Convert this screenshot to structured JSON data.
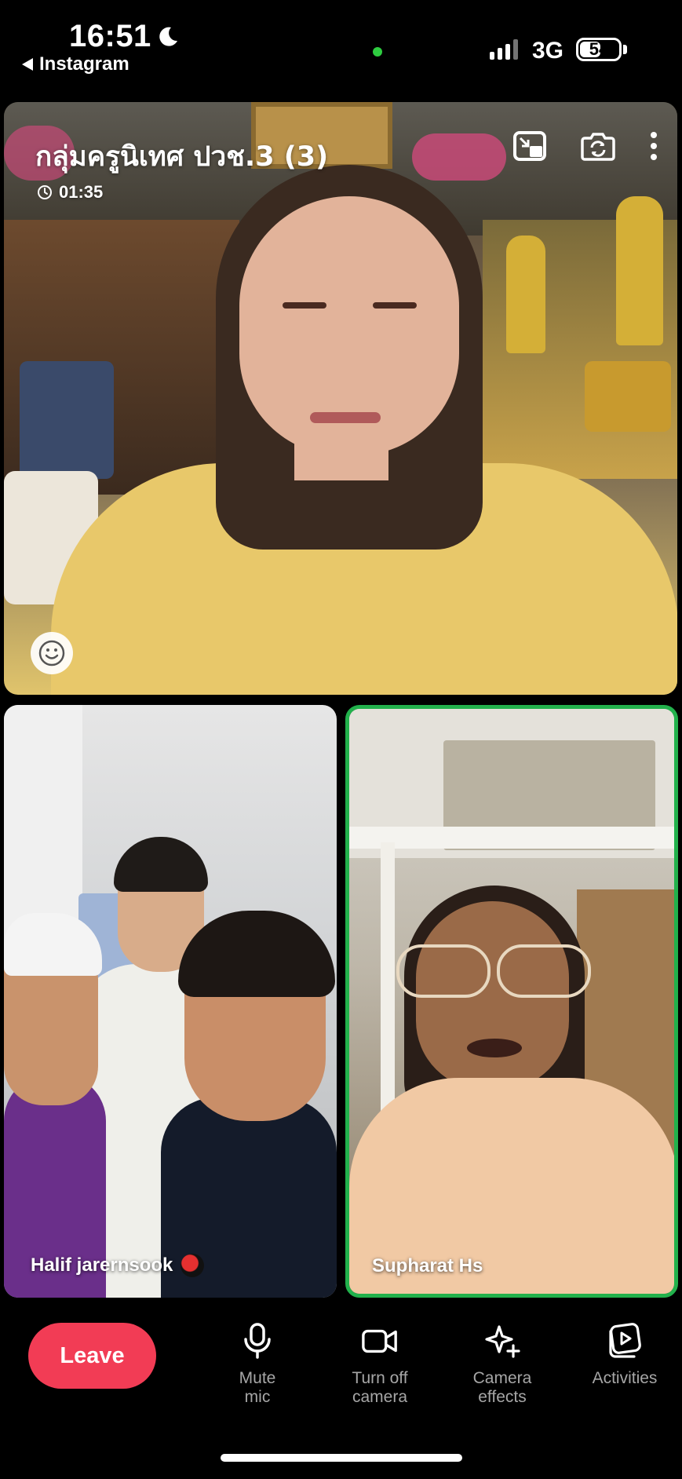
{
  "status_bar": {
    "time": "16:51",
    "back_app": "Instagram",
    "network": "3G",
    "battery": "54",
    "battery_level": 0.54
  },
  "call": {
    "title": "กลุ่มครูนิเทศ ปวช.3 (3)",
    "timer": "01:35"
  },
  "participants": [
    {
      "name": "Halif jarernsook"
    },
    {
      "name": "Supharat Hs",
      "speaking": true
    }
  ],
  "controls": {
    "leave": "Leave",
    "mute": "Mute\nmic",
    "camera": "Turn off\ncamera",
    "effects": "Camera\neffects",
    "activities": "Activities"
  },
  "colors": {
    "leave": "#f23c55",
    "speaking_border": "#22b14c",
    "camera_indicator": "#2ecc40"
  },
  "icons": [
    "moon-icon",
    "back-triangle-icon",
    "signal-icon",
    "battery-icon",
    "picture-in-picture-icon",
    "flip-camera-icon",
    "more-icon",
    "clock-icon",
    "emoji-icon",
    "microphone-icon",
    "video-camera-icon",
    "sparkles-icon",
    "activities-icon"
  ]
}
